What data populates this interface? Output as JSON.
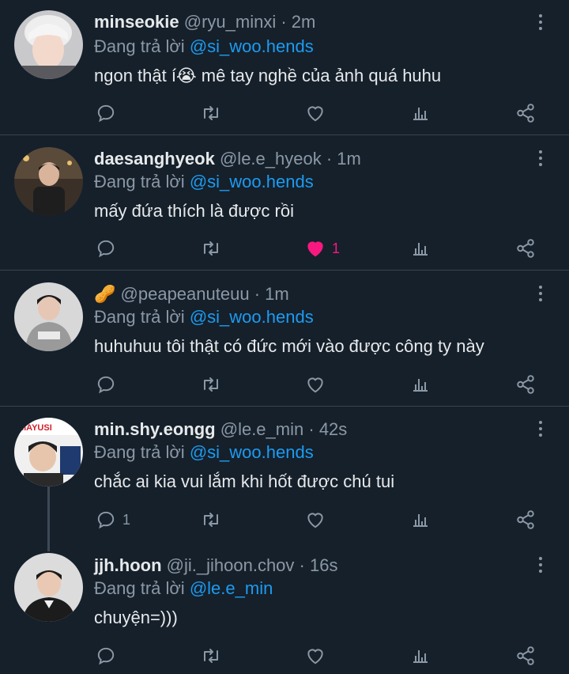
{
  "tweets": [
    {
      "name": "minseokie",
      "handle": "@ryu_minxi",
      "time": "2m",
      "reply_prefix": "Đang trả lời",
      "reply_to": "@si_woo.hends",
      "text": "ngon thật í😭 mê tay nghề của ảnh quá huhu",
      "reply_count": "",
      "like_count": "",
      "liked": false
    },
    {
      "name": "daesanghyeok",
      "handle": "@le.e_hyeok",
      "time": "1m",
      "reply_prefix": "Đang trả lời",
      "reply_to": "@si_woo.hends",
      "text": "mấy đứa thích là được rồi",
      "reply_count": "",
      "like_count": "1",
      "liked": true
    },
    {
      "name": "🥜",
      "handle": "@peapeanuteuu",
      "time": "1m",
      "reply_prefix": "Đang trả lời",
      "reply_to": "@si_woo.hends",
      "text": "huhuhuu tôi thật có đức mới vào được công ty này",
      "reply_count": "",
      "like_count": "",
      "liked": false
    },
    {
      "name": "min.shy.eongg",
      "handle": "@le.e_min",
      "time": "42s",
      "reply_prefix": "Đang trả lời",
      "reply_to": "@si_woo.hends",
      "text": "chắc ai kia vui lắm khi hốt được chú tui",
      "reply_count": "1",
      "like_count": "",
      "liked": false
    },
    {
      "name": "jjh.hoon",
      "handle": "@ji._jihoon.chov",
      "time": "16s",
      "reply_prefix": "Đang trả lời",
      "reply_to": "@le.e_min",
      "text": "chuyện=)))",
      "reply_count": "",
      "like_count": "",
      "liked": false
    }
  ],
  "separator": "·",
  "colors": {
    "background": "#15202b",
    "mention": "#1d9bf0",
    "muted": "#8b98a5",
    "like": "#f91880",
    "divider": "#38444d"
  },
  "icons": [
    "reply-icon",
    "retweet-icon",
    "like-icon",
    "views-icon",
    "share-icon",
    "more-icon"
  ]
}
